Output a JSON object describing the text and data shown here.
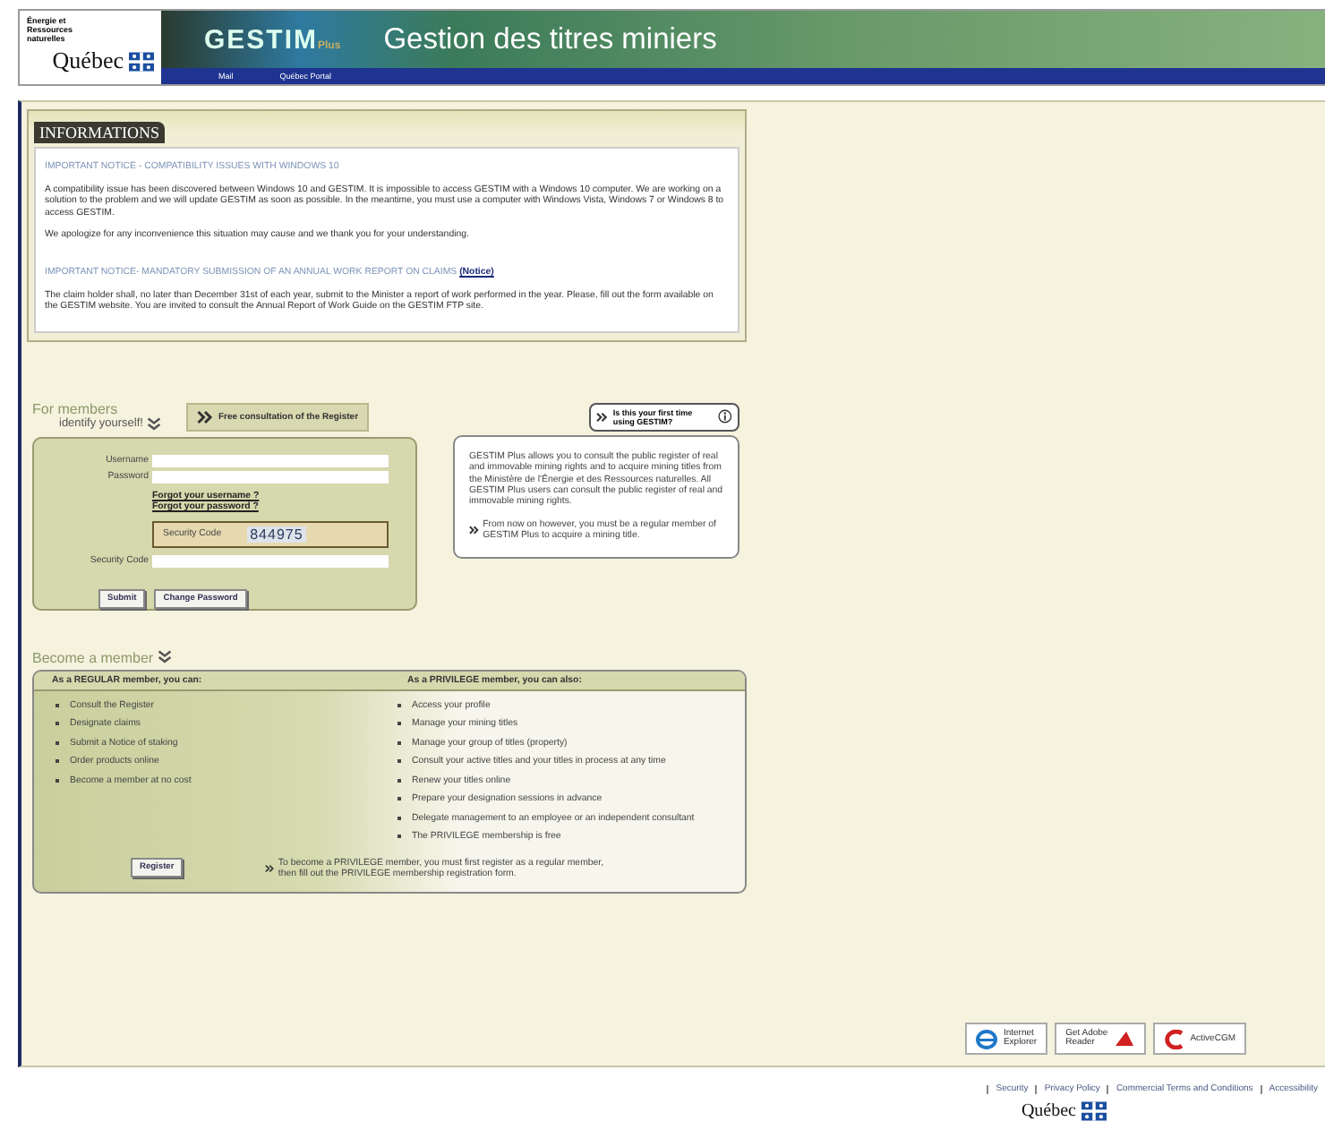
{
  "header": {
    "ministry": "Énergie et Ressources naturelles",
    "logo": "Québec",
    "product": "GESTIM",
    "product_suffix": "Plus",
    "title": "Gestion des titres miniers",
    "links": [
      "Mail",
      "Québec Portal"
    ]
  },
  "informations": {
    "heading": "INFORMATIONS",
    "notices": [
      {
        "title": "IMPORTANT NOTICE - COMPATIBILITY ISSUES WITH WINDOWS 10",
        "paragraphs": [
          "A compatibility issue has been discovered between Windows 10 and GESTIM. It is impossible to access GESTIM with a Windows 10 computer. We are working on a solution to the problem and we will update GESTIM as soon as possible. In the meantime, you must use a computer with Windows Vista, Windows 7 or Windows 8 to access GESTIM.",
          "We apologize for any inconvenience this situation may cause and we thank you for your understanding."
        ]
      },
      {
        "title": "IMPORTANT NOTICE- MANDATORY SUBMISSION OF AN ANNUAL WORK REPORT ON CLAIMS",
        "link": "(Notice)",
        "paragraphs": [
          "The claim holder shall, no later than December 31st of each year, submit to the Minister a report of work performed in the year. Please, fill out the form available on the GESTIM website. You are invited to consult the Annual Report of Work Guide on the GESTIM FTP site."
        ]
      }
    ]
  },
  "members": {
    "heading": "For members",
    "subheading": "identify yourself!",
    "register_button": "Free consultation of the Register",
    "fields": [
      {
        "label": "Username"
      },
      {
        "label": "Password"
      }
    ],
    "links": [
      "Forgot your username ?",
      "Forgot your password ?"
    ],
    "captcha_label": "Security Code",
    "captcha_value": "844975",
    "code_field": {
      "label": "Security Code"
    },
    "buttons": [
      "Submit",
      "Change Password"
    ]
  },
  "first_time": {
    "button": "Is this your first time using GESTIM?",
    "text": "GESTIM Plus allows you to consult the public register of real and immovable mining rights and to acquire mining titles from the Ministère de l'Énergie et des Ressources naturelles. All GESTIM Plus users can consult the public register of real and immovable mining rights.",
    "note": "From now on however, you must be a regular member of GESTIM Plus to acquire a mining title."
  },
  "become": {
    "heading": "Become a member",
    "regular_heading": "As a REGULAR member, you can:",
    "privilege_heading": "As a PRIVILEGE member, you can also:",
    "regular": [
      "Consult the Register",
      "Designate claims",
      "Submit a Notice of staking",
      "Order products online",
      "Become a member at no cost"
    ],
    "privilege": [
      "Access your profile",
      "Manage your mining titles",
      "Manage your group of titles (property)",
      "Consult your active titles and your titles in process at any time",
      "Renew your titles online",
      "Prepare your designation sessions in advance",
      "Delegate management to an employee or an independent consultant",
      "The PRIVILEGE membership is free"
    ],
    "register_button": "Register",
    "privilege_note": "To become a PRIVILEGE member, you must first register as a regular member, then fill out the PRIVILEGE membership registration form."
  },
  "badges": [
    {
      "kind": "ie",
      "lines": [
        "Internet",
        "Explorer"
      ]
    },
    {
      "kind": "reader",
      "lines": [
        "Get Adobe",
        "Reader"
      ]
    },
    {
      "kind": "activecgm",
      "lines": [
        "ActiveCGM"
      ]
    }
  ],
  "footer": {
    "links": [
      "Security",
      "Privacy Policy",
      "Commercial Terms and Conditions",
      "Accessibility"
    ],
    "logo": "Québec"
  }
}
